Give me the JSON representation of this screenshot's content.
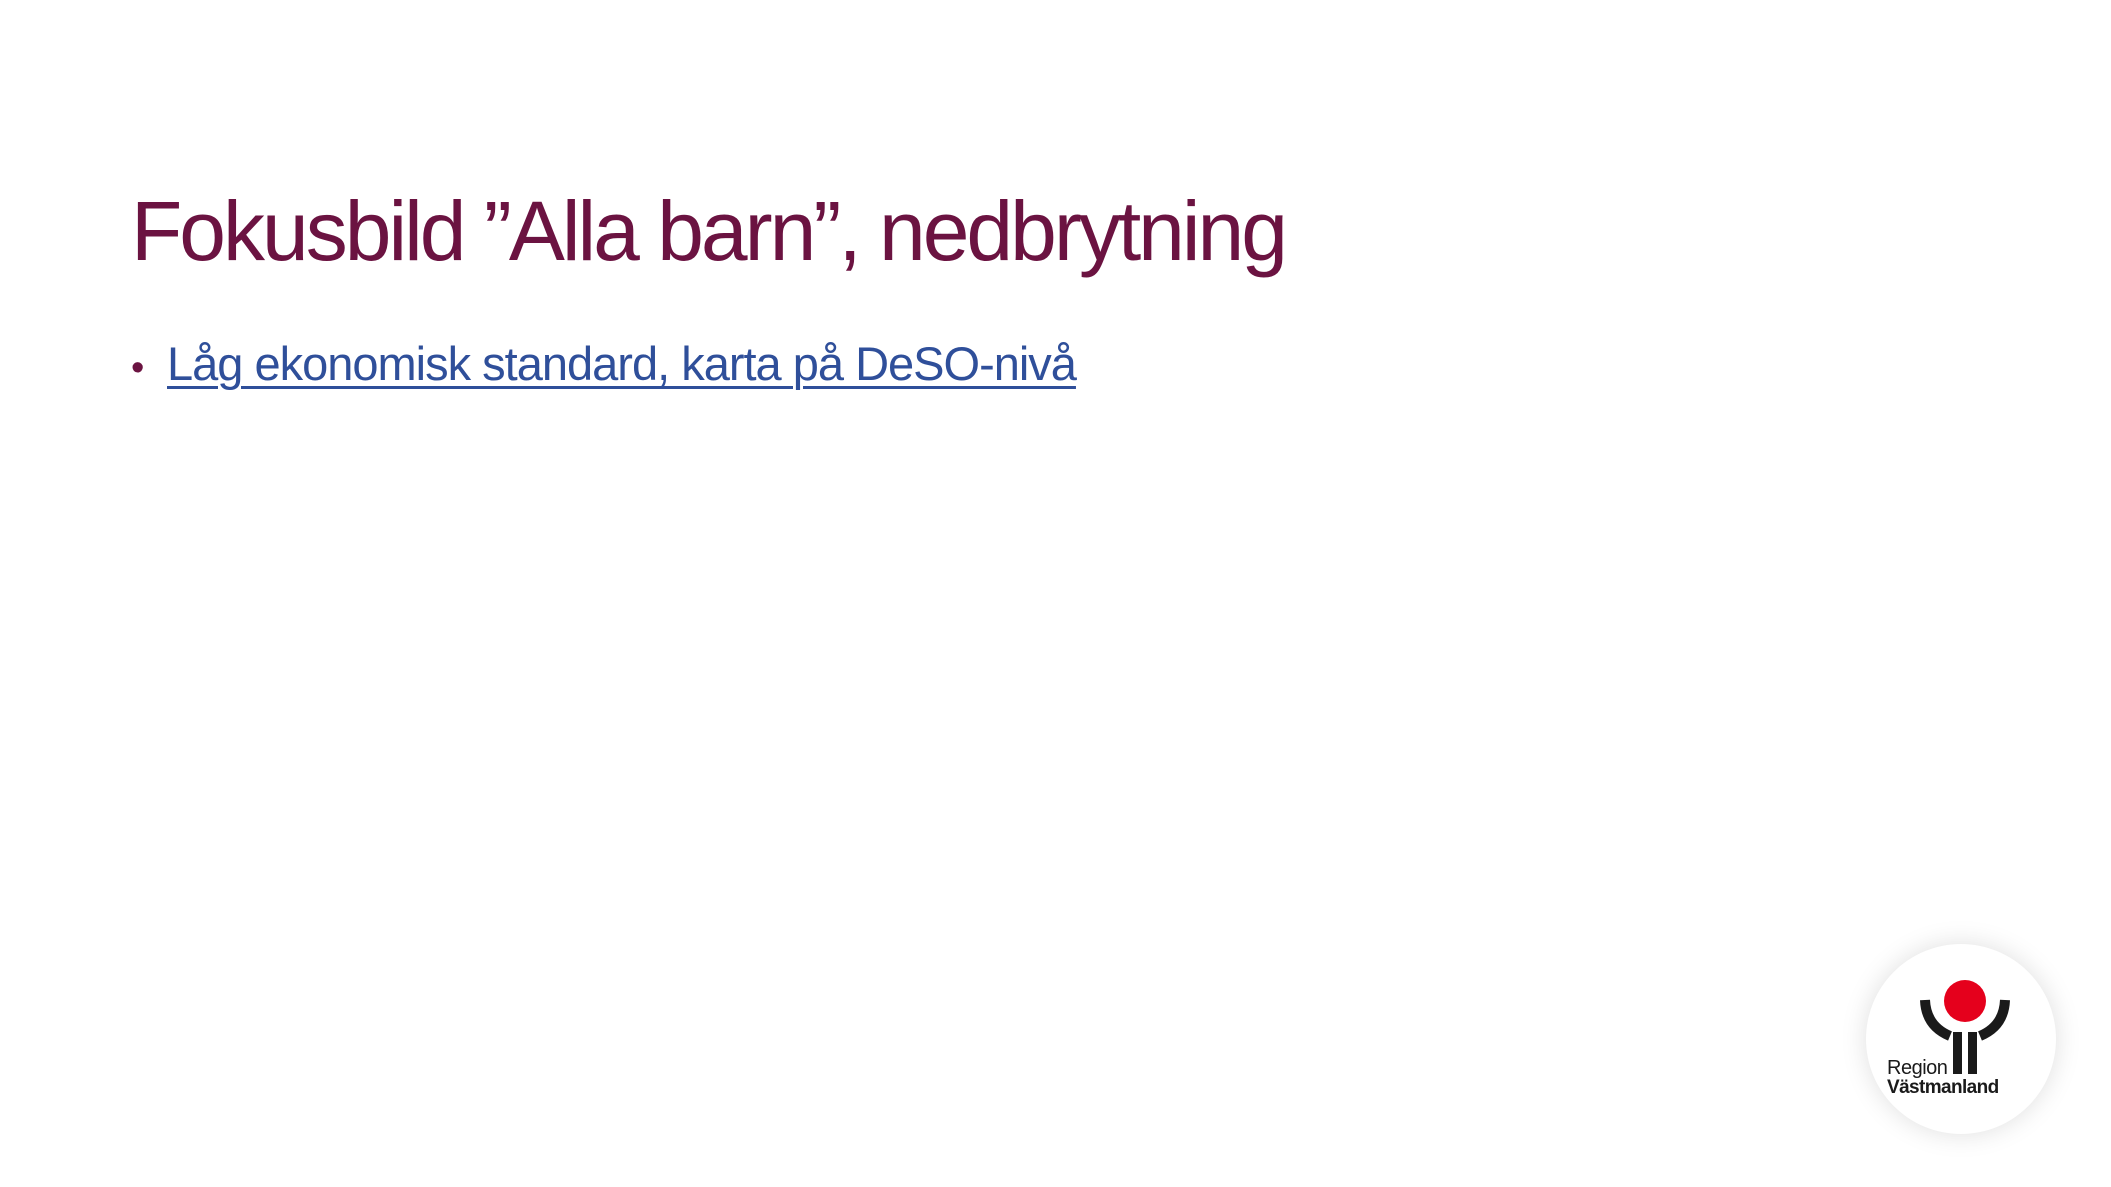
{
  "slide": {
    "title": "Fokusbild ”Alla barn”, nedbrytning",
    "bullets": [
      {
        "text": "Låg ekonomisk standard, karta på DeSO-nivå"
      }
    ]
  },
  "logo": {
    "line1": "Region",
    "line2": "Västmanland"
  },
  "colors": {
    "title": "#6b1341",
    "bullet_dot": "#6b1341",
    "link": "#2f4f9a",
    "logo_red": "#e5001c",
    "logo_black": "#1a1a1a"
  },
  "icons": {
    "logo_symbol": "region-vastmanland-logo-icon"
  }
}
